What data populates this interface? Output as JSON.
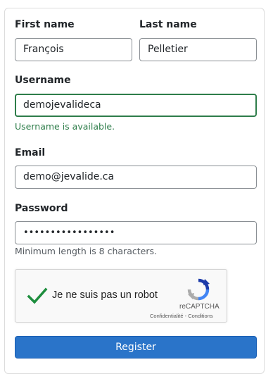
{
  "form": {
    "first_name": {
      "label": "First name",
      "value": "François"
    },
    "last_name": {
      "label": "Last name",
      "value": "Pelletier"
    },
    "username": {
      "label": "Username",
      "value": "demojevalideca",
      "help": "Username is available."
    },
    "email": {
      "label": "Email",
      "value": "demo@jevalide.ca"
    },
    "password": {
      "label": "Password",
      "value": "•••••••••••••••••",
      "help": "Minimum length is 8 characters."
    }
  },
  "captcha": {
    "label": "Je ne suis pas un robot",
    "brand": "reCAPTCHA",
    "privacy": "Confidentialité",
    "separator": " - ",
    "terms": "Conditions",
    "checked": true,
    "check_color": "#1e8e3e"
  },
  "submit": {
    "label": "Register",
    "color": "#2a74c9"
  },
  "colors": {
    "valid": "#2e7d4a"
  }
}
